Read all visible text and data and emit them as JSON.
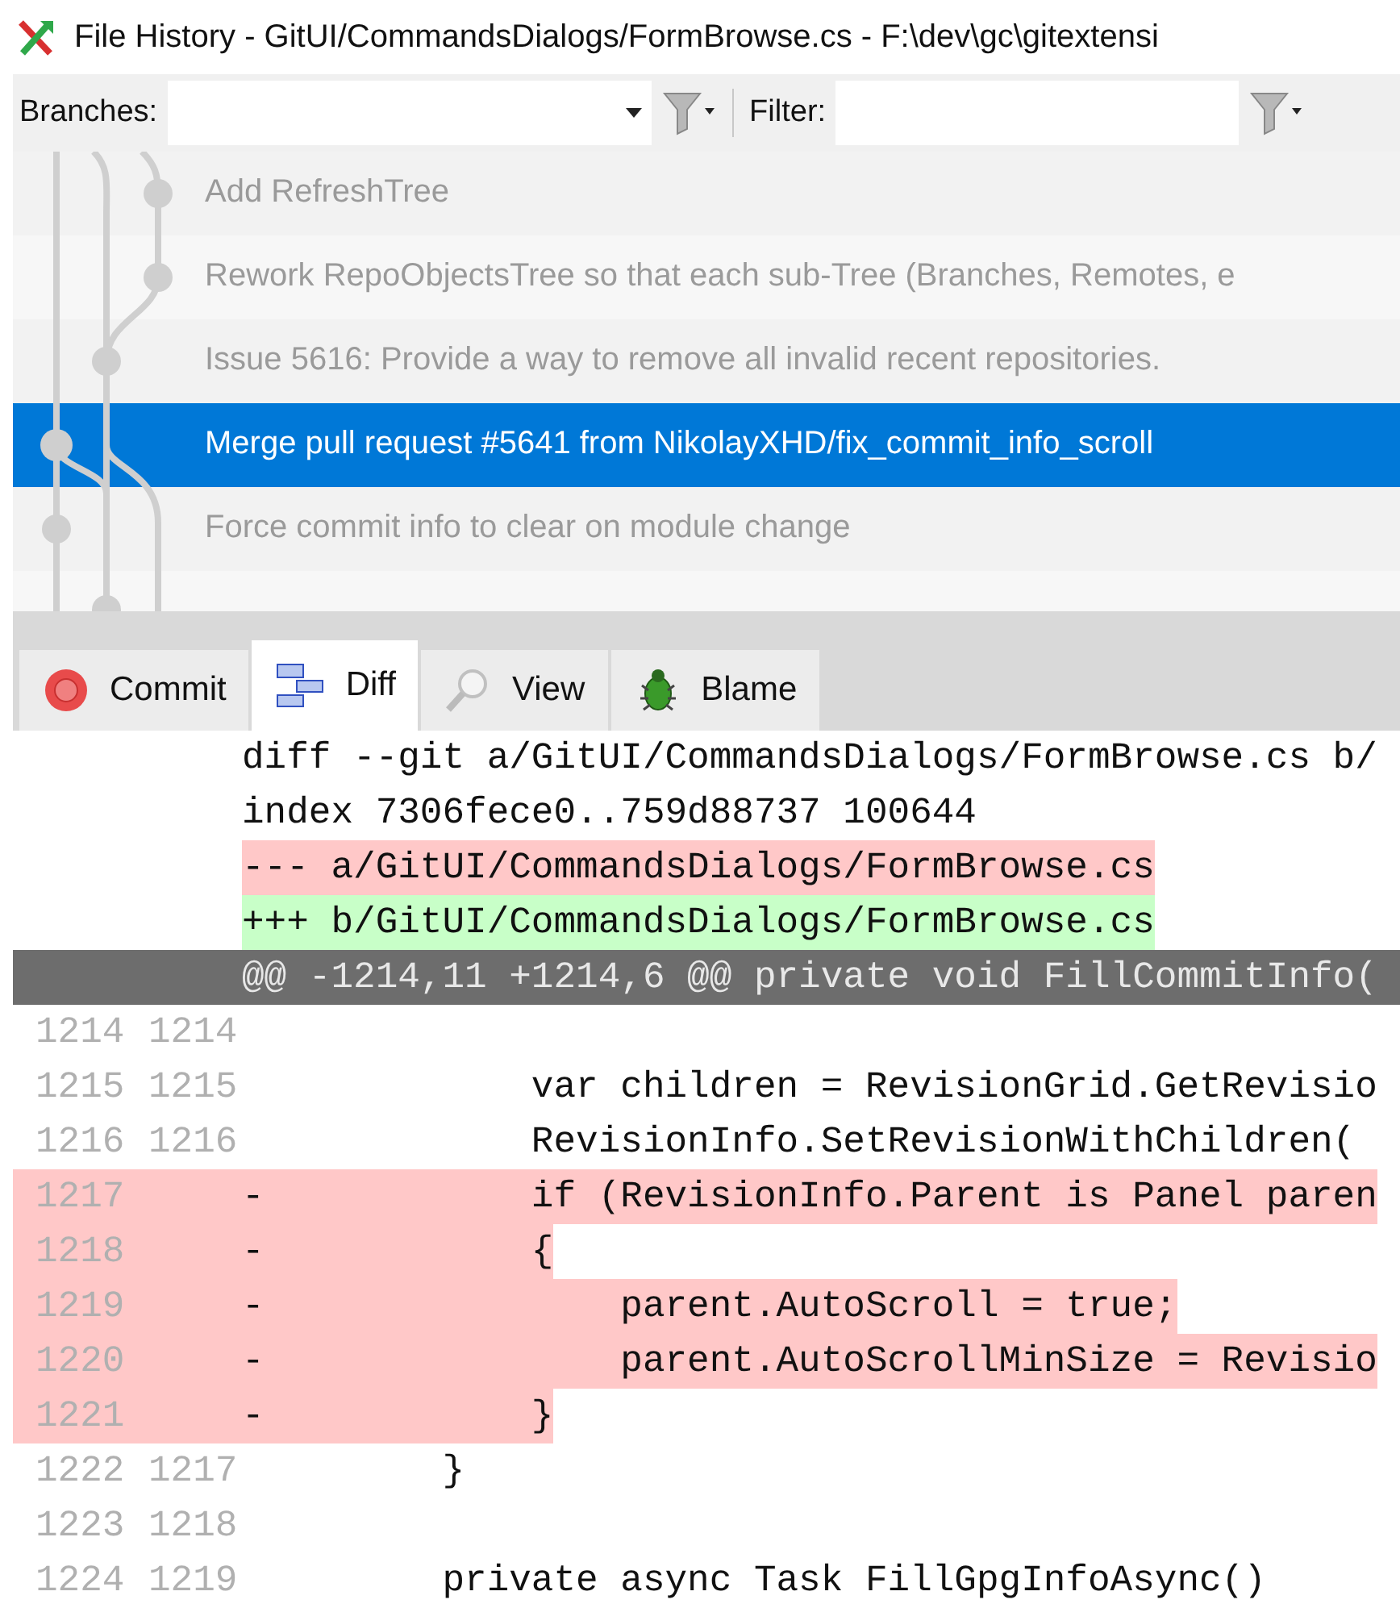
{
  "window": {
    "title": "File History - GitUI/CommandsDialogs/FormBrowse.cs - F:\\dev\\gc\\gitextensi"
  },
  "toolbar": {
    "branches_label": "Branches:",
    "filter_label": "Filter:"
  },
  "commits": [
    {
      "message": "Add RefreshTree",
      "selected": false
    },
    {
      "message": "Rework RepoObjectsTree so that each sub-Tree (Branches, Remotes, e",
      "selected": false
    },
    {
      "message": "Issue 5616: Provide a way to remove all invalid recent repositories.",
      "selected": false
    },
    {
      "message": "Merge pull request #5641 from NikolayXHD/fix_commit_info_scroll",
      "selected": true
    },
    {
      "message": "Force commit info to clear on module change",
      "selected": false
    }
  ],
  "tabs": [
    {
      "label": "Commit",
      "kind": "commit",
      "selected": false
    },
    {
      "label": "Diff",
      "kind": "diff",
      "selected": true
    },
    {
      "label": "View",
      "kind": "view",
      "selected": false
    },
    {
      "label": "Blame",
      "kind": "blame",
      "selected": false
    }
  ],
  "diff": {
    "header": [
      {
        "kind": "meta",
        "text": "diff --git a/GitUI/CommandsDialogs/FormBrowse.cs b/"
      },
      {
        "kind": "meta",
        "text": "index 7306fece0..759d88737 100644"
      },
      {
        "kind": "removed",
        "text": "--- a/GitUI/CommandsDialogs/FormBrowse.cs"
      },
      {
        "kind": "added",
        "text": "+++ b/GitUI/CommandsDialogs/FormBrowse.cs"
      },
      {
        "kind": "hunk",
        "text": "@@ -1214,11 +1214,6 @@ private void FillCommitInfo("
      }
    ],
    "lines": [
      {
        "kind": "context",
        "old": "1214",
        "new": "1214"
      },
      {
        "kind": "context",
        "old": "1215",
        "new": "1215",
        "code": "            var children = RevisionGrid.GetRevisio"
      },
      {
        "kind": "context",
        "old": "1216",
        "new": "1216",
        "code": "            RevisionInfo.SetRevisionWithChildren("
      },
      {
        "kind": "removed",
        "old": "1217",
        "marker": "-",
        "code": "            if (RevisionInfo.Parent is Panel paren"
      },
      {
        "kind": "removed",
        "old": "1218",
        "marker": "-",
        "code": "            {"
      },
      {
        "kind": "removed",
        "old": "1219",
        "marker": "-",
        "code": "                parent.AutoScroll = true;"
      },
      {
        "kind": "removed",
        "old": "1220",
        "marker": "-",
        "code": "                parent.AutoScrollMinSize = Revisio"
      },
      {
        "kind": "removed",
        "old": "1221",
        "marker": "-",
        "code": "            }"
      },
      {
        "kind": "context",
        "old": "1222",
        "new": "1217",
        "code": "        }"
      },
      {
        "kind": "context",
        "old": "1223",
        "new": "1218"
      },
      {
        "kind": "context",
        "old": "1224",
        "new": "1219",
        "code": "        private async Task FillGpgInfoAsync()"
      }
    ]
  }
}
